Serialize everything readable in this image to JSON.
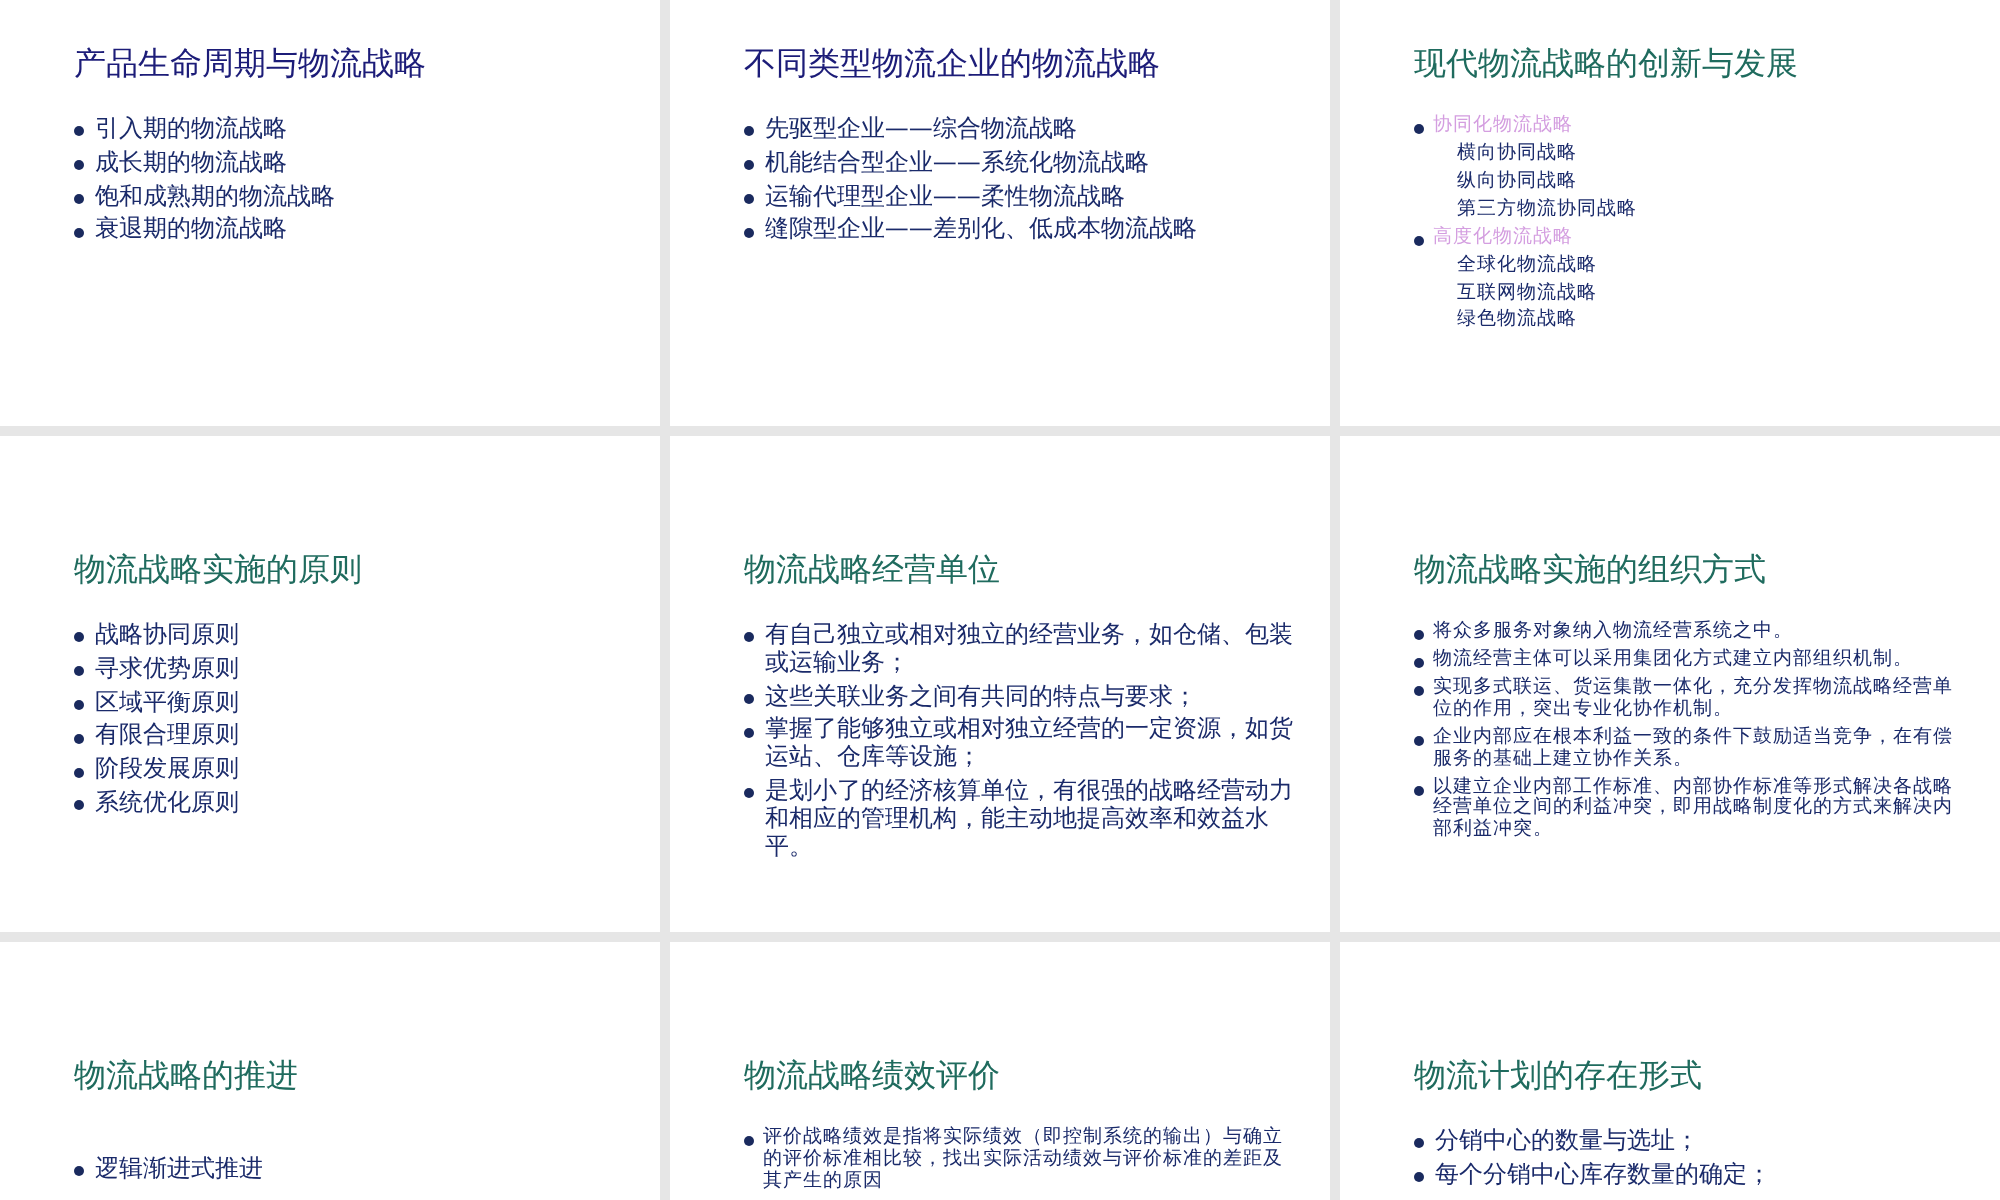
{
  "slides": [
    {
      "kind": "normal",
      "title": "产品生命周期与物流战略",
      "color": "#1c1c78",
      "items": [
        {
          "kind": "bullet",
          "text": "引入期的物流战略"
        },
        {
          "kind": "bullet",
          "text": "成长期的物流战略"
        },
        {
          "kind": "bullet",
          "text": "饱和成熟期的物流战略"
        },
        {
          "kind": "bullet",
          "text": "衰退期的物流战略"
        }
      ]
    },
    {
      "kind": "normal",
      "title": "不同类型物流企业的物流战略",
      "color": "#1c1c78",
      "items": [
        {
          "kind": "bullet",
          "text": "先驱型企业——综合物流战略"
        },
        {
          "kind": "bullet",
          "text": "机能结合型企业——系统化物流战略"
        },
        {
          "kind": "bullet",
          "text": "运输代理型企业——柔性物流战略"
        },
        {
          "kind": "bullet",
          "text": "缝隙型企业——差别化、低成本物流战略"
        }
      ]
    },
    {
      "kind": "compact",
      "title": "现代物流战略的创新与发展",
      "color": "#1f6b5e",
      "items": [
        {
          "kind": "heading",
          "text": "协同化物流战略"
        },
        {
          "kind": "sub",
          "text": "横向协同战略"
        },
        {
          "kind": "sub",
          "text": "纵向协同战略"
        },
        {
          "kind": "sub",
          "text": "第三方物流协同战略"
        },
        {
          "kind": "heading",
          "text": "高度化物流战略"
        },
        {
          "kind": "sub",
          "text": "全球化物流战略"
        },
        {
          "kind": "sub",
          "text": "互联网物流战略"
        },
        {
          "kind": "sub",
          "text": "绿色物流战略"
        }
      ]
    },
    {
      "kind": "normal",
      "title": "物流战略实施的原则",
      "color": "#1f6b5e",
      "items": [
        {
          "kind": "bullet",
          "text": "战略协同原则"
        },
        {
          "kind": "bullet",
          "text": "寻求优势原则"
        },
        {
          "kind": "bullet",
          "text": "区域平衡原则"
        },
        {
          "kind": "bullet",
          "text": "有限合理原则"
        },
        {
          "kind": "bullet",
          "text": "阶段发展原则"
        },
        {
          "kind": "bullet",
          "text": "系统优化原则"
        }
      ]
    },
    {
      "kind": "normal",
      "title": "物流战略经营单位",
      "color": "#1f6b5e",
      "items": [
        {
          "kind": "bullet",
          "text": "有自己独立或相对独立的经营业务，如仓储、包装或运输业务；"
        },
        {
          "kind": "bullet",
          "text": "这些关联业务之间有共同的特点与要求；"
        },
        {
          "kind": "bullet",
          "text": "掌握了能够独立或相对独立经营的一定资源，如货运站、仓库等设施；"
        },
        {
          "kind": "bullet",
          "text": "是划小了的经济核算单位，有很强的战略经营动力和相应的管理机构，能主动地提高效率和效益水平。"
        }
      ]
    },
    {
      "kind": "compact",
      "title": "物流战略实施的组织方式",
      "color": "#1f6b5e",
      "items": [
        {
          "kind": "bullet",
          "text": "将众多服务对象纳入物流经营系统之中。"
        },
        {
          "kind": "bullet",
          "text": "物流经营主体可以采用集团化方式建立内部组织机制。"
        },
        {
          "kind": "bullet",
          "text": "实现多式联运、货运集散一体化，充分发挥物流战略经营单位的作用，突出专业化协作机制。"
        },
        {
          "kind": "bullet",
          "text": "企业内部应在根本利益一致的条件下鼓励适当竞争，在有偿服务的基础上建立协作关系。"
        },
        {
          "kind": "bullet",
          "text": "以建立企业内部工作标准、内部协作标准等形式解决各战略经营单位之间的利益冲突，即用战略制度化的方式来解决内部利益冲突。"
        }
      ]
    },
    {
      "kind": "spaced",
      "title": "物流战略的推进",
      "color": "#1f6b5e",
      "items": [
        {
          "kind": "bullet",
          "text": "逻辑渐进式推进"
        }
      ]
    },
    {
      "kind": "compact",
      "title": "物流战略绩效评价",
      "color": "#1f6b5e",
      "items": [
        {
          "kind": "bullet",
          "text": "评价战略绩效是指将实际绩效（即控制系统的输出）与确立的评价标准相比较，找出实际活动绩效与评价标准的差距及其产生的原因"
        }
      ]
    },
    {
      "kind": "normal",
      "title": "物流计划的存在形式",
      "color": "#1f6b5e",
      "items": [
        {
          "kind": "bullet",
          "text": "分销中心的数量与选址；"
        },
        {
          "kind": "bullet",
          "text": "每个分销中心库存数量的确定；"
        }
      ]
    }
  ]
}
